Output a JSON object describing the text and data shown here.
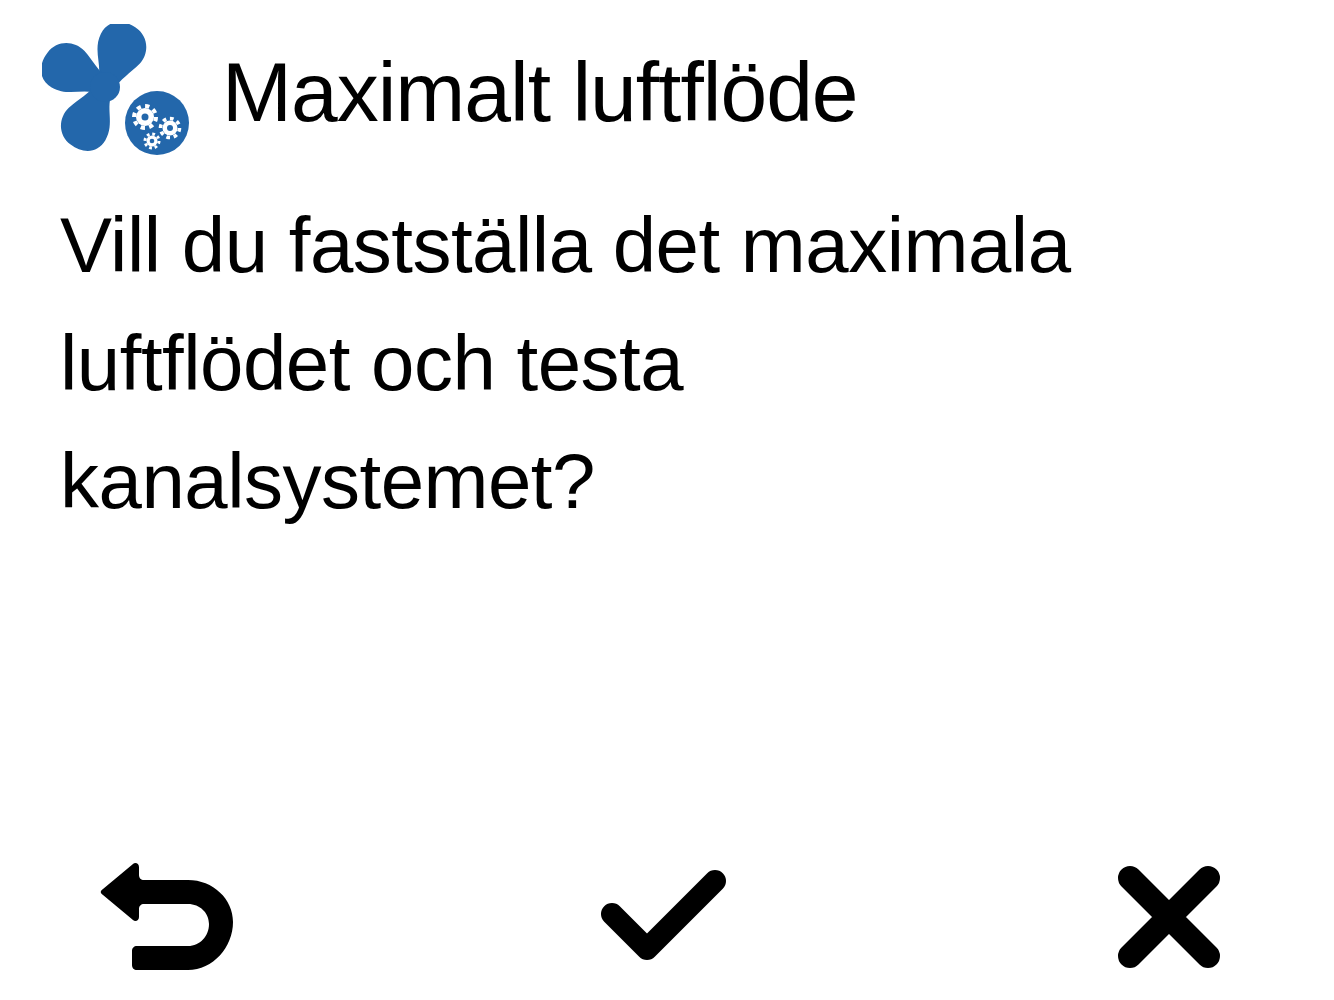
{
  "header": {
    "title": "Maximalt luftflöde"
  },
  "message": "Vill du fastställa det maximala luftflödet och testa kanalsystemet?",
  "buttons": [
    {
      "kind": "back"
    },
    {
      "kind": "confirm"
    },
    {
      "kind": "cancel"
    }
  ]
}
